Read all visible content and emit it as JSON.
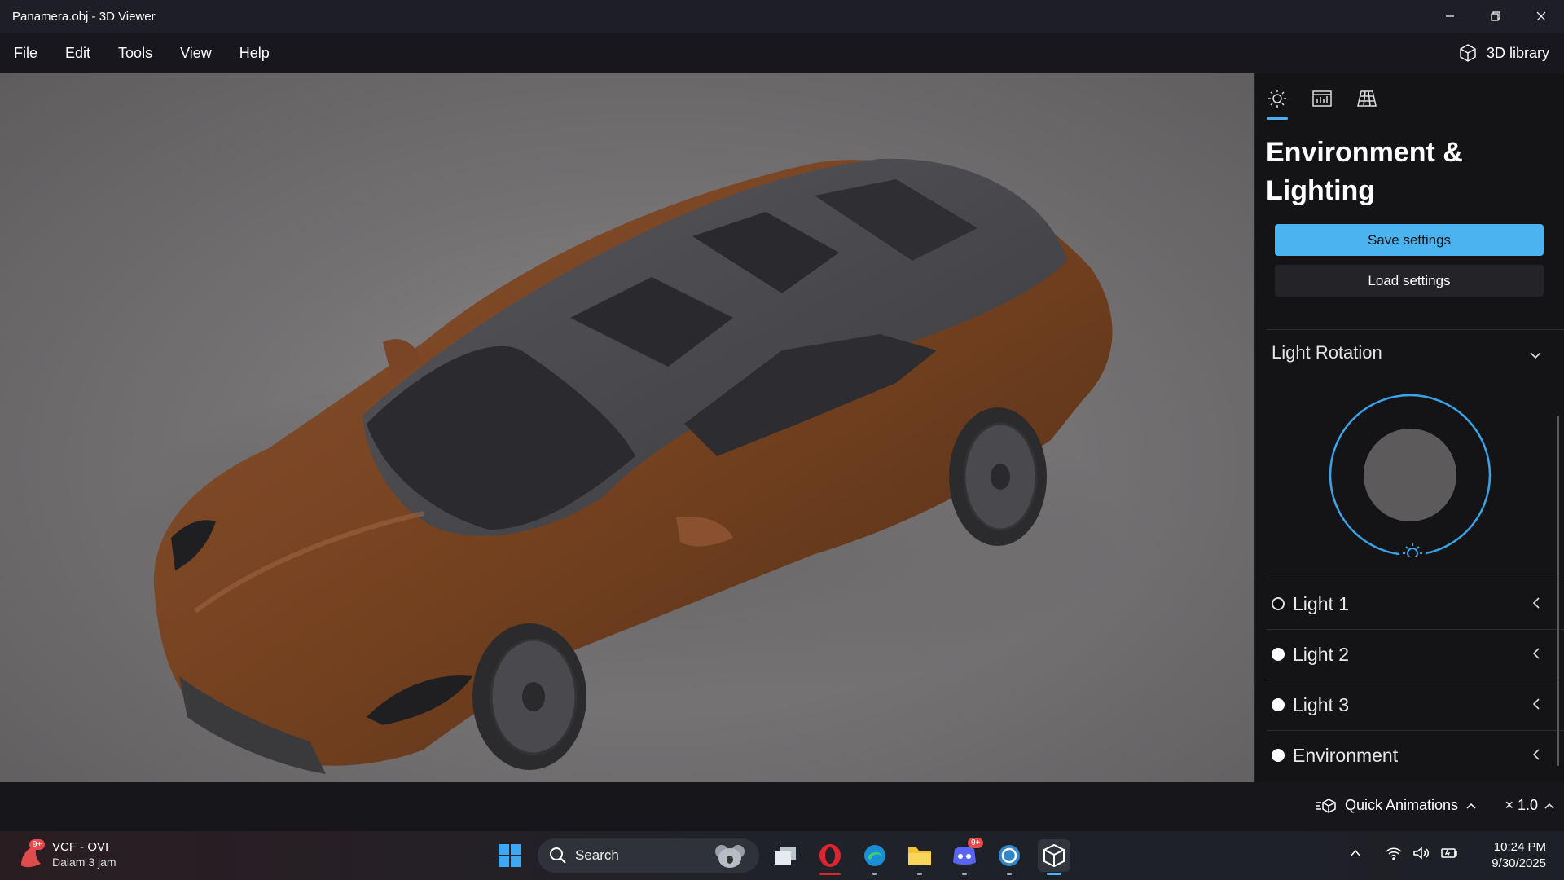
{
  "window": {
    "title": "Panamera.obj - 3D Viewer"
  },
  "menu": {
    "items": [
      "File",
      "Edit",
      "Tools",
      "View",
      "Help"
    ],
    "library_label": "3D library"
  },
  "panel": {
    "tabs": [
      "lighting-icon",
      "stats-icon",
      "grid-icon"
    ],
    "title": "Environment & Lighting",
    "save_label": "Save settings",
    "load_label": "Load settings",
    "section_title": "Light Rotation",
    "lights": [
      {
        "label": "Light 1"
      },
      {
        "label": "Light 2"
      },
      {
        "label": "Light 3"
      },
      {
        "label": "Environment"
      }
    ]
  },
  "statusbar": {
    "quick_animations": "Quick Animations",
    "speed": "× 1.0"
  },
  "taskbar": {
    "weather_title": "VCF - OVI",
    "weather_sub": "Dalam 3 jam",
    "weather_badge": "9+",
    "search_label": "Search",
    "discord_badge": "9+",
    "time": "10:24 PM",
    "date": "9/30/2025"
  },
  "colors": {
    "accent": "#4ab3f0",
    "car_body": "#7a4527",
    "panel_bg": "#141416"
  }
}
